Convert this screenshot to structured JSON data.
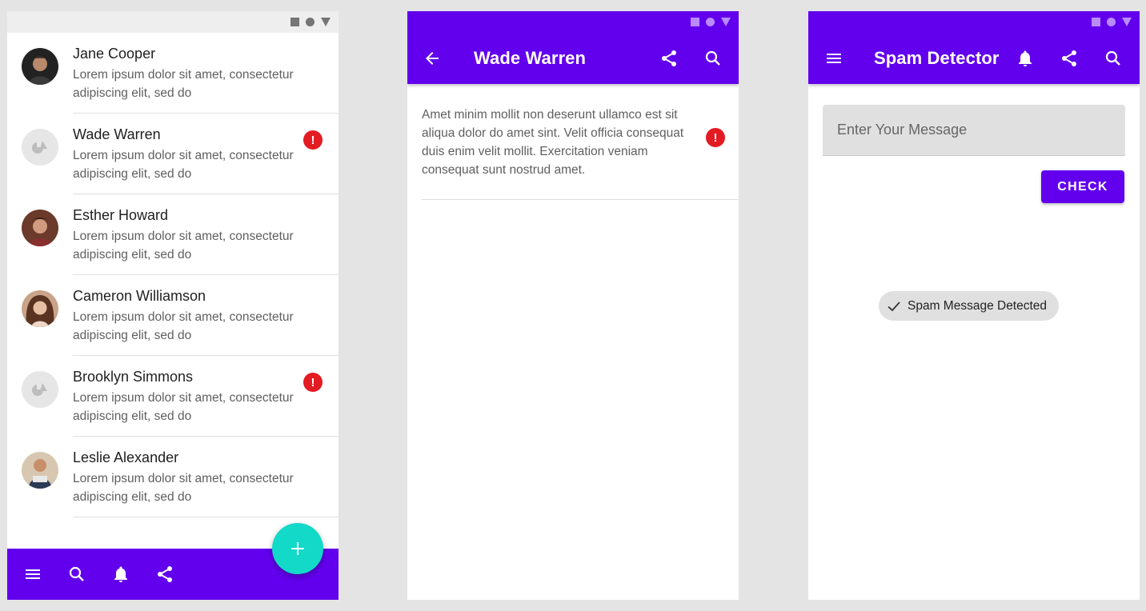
{
  "list_screen": {
    "items": [
      {
        "name": "Jane Cooper",
        "preview": "Lorem ipsum dolor sit amet, consectetur adipiscing elit, sed do",
        "avatar": "photo",
        "alert": false
      },
      {
        "name": "Wade Warren",
        "preview": "Lorem ipsum dolor sit amet, consectetur adipiscing elit, sed do",
        "avatar": "placeholder",
        "alert": true
      },
      {
        "name": "Esther Howard",
        "preview": "Lorem ipsum dolor sit amet, consectetur adipiscing elit, sed do",
        "avatar": "photo",
        "alert": false
      },
      {
        "name": "Cameron Williamson",
        "preview": "Lorem ipsum dolor sit amet, consectetur adipiscing elit, sed do",
        "avatar": "photo",
        "alert": false
      },
      {
        "name": "Brooklyn Simmons",
        "preview": "Lorem ipsum dolor sit amet, consectetur adipiscing elit, sed do",
        "avatar": "placeholder",
        "alert": true
      },
      {
        "name": "Leslie Alexander",
        "preview": "Lorem ipsum dolor sit amet, consectetur adipiscing elit, sed do",
        "avatar": "photo",
        "alert": false
      }
    ],
    "alert_glyph": "!",
    "fab_icon": "plus-icon",
    "bottom_bar_icons": [
      "menu-icon",
      "search-icon",
      "bell-icon",
      "share-icon"
    ]
  },
  "detail_screen": {
    "title": "Wade Warren",
    "body": "Amet minim mollit non deserunt ullamco est sit aliqua dolor do amet sint. Velit officia consequat duis enim velit mollit. Exercitation veniam consequat sunt nostrud amet.",
    "alert_glyph": "!"
  },
  "spam_screen": {
    "title": "Spam Detector",
    "input_placeholder": "Enter Your Message",
    "check_label": "CHECK",
    "result_chip": "Spam Message Detected"
  },
  "colors": {
    "primary": "#6200ee",
    "fab": "#12d9c8",
    "alert": "#e31b23",
    "background": "#e4e4e4"
  }
}
